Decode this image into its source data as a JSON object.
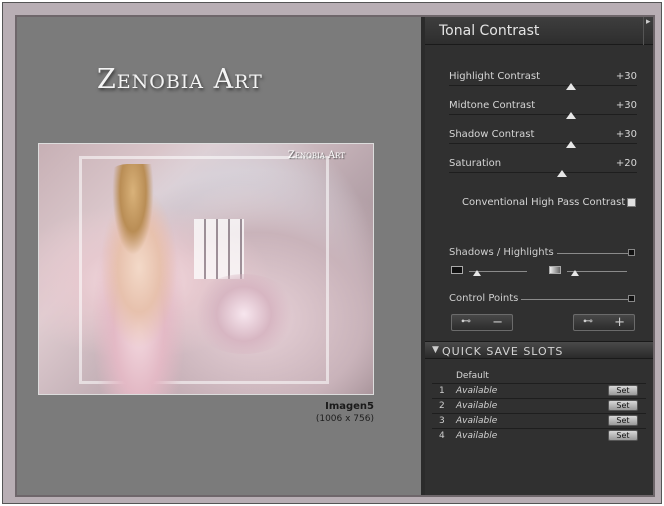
{
  "brand": {
    "title": "Zenobia Art"
  },
  "preview": {
    "image_watermark": "Zenobia Art",
    "image_name": "Imagen5",
    "image_size": "(1006 x 756)"
  },
  "panel": {
    "title": "Tonal Contrast",
    "sliders": [
      {
        "label": "Highlight Contrast",
        "value": "+30",
        "fraction": 0.65
      },
      {
        "label": "Midtone Contrast",
        "value": "+30",
        "fraction": 0.65
      },
      {
        "label": "Shadow Contrast",
        "value": "+30",
        "fraction": 0.65
      },
      {
        "label": "Saturation",
        "value": "+20",
        "fraction": 0.6
      }
    ],
    "checkbox_label": "Conventional High Pass Contrast",
    "checkbox_checked": false,
    "shadows_highlights_label": "Shadows / Highlights",
    "control_points_label": "Control Points",
    "remove_sign": "−",
    "add_sign": "+"
  },
  "quick_save": {
    "title": "QUICK SAVE SLOTS",
    "default_label": "Default",
    "slots": [
      {
        "number": "1",
        "name": "Available",
        "button": "Set"
      },
      {
        "number": "2",
        "name": "Available",
        "button": "Set"
      },
      {
        "number": "3",
        "name": "Available",
        "button": "Set"
      },
      {
        "number": "4",
        "name": "Available",
        "button": "Set"
      }
    ]
  },
  "colors": {
    "panel_bg": "#303030",
    "preview_bg": "#7b7b7b",
    "frame": "#b8aeb4"
  }
}
